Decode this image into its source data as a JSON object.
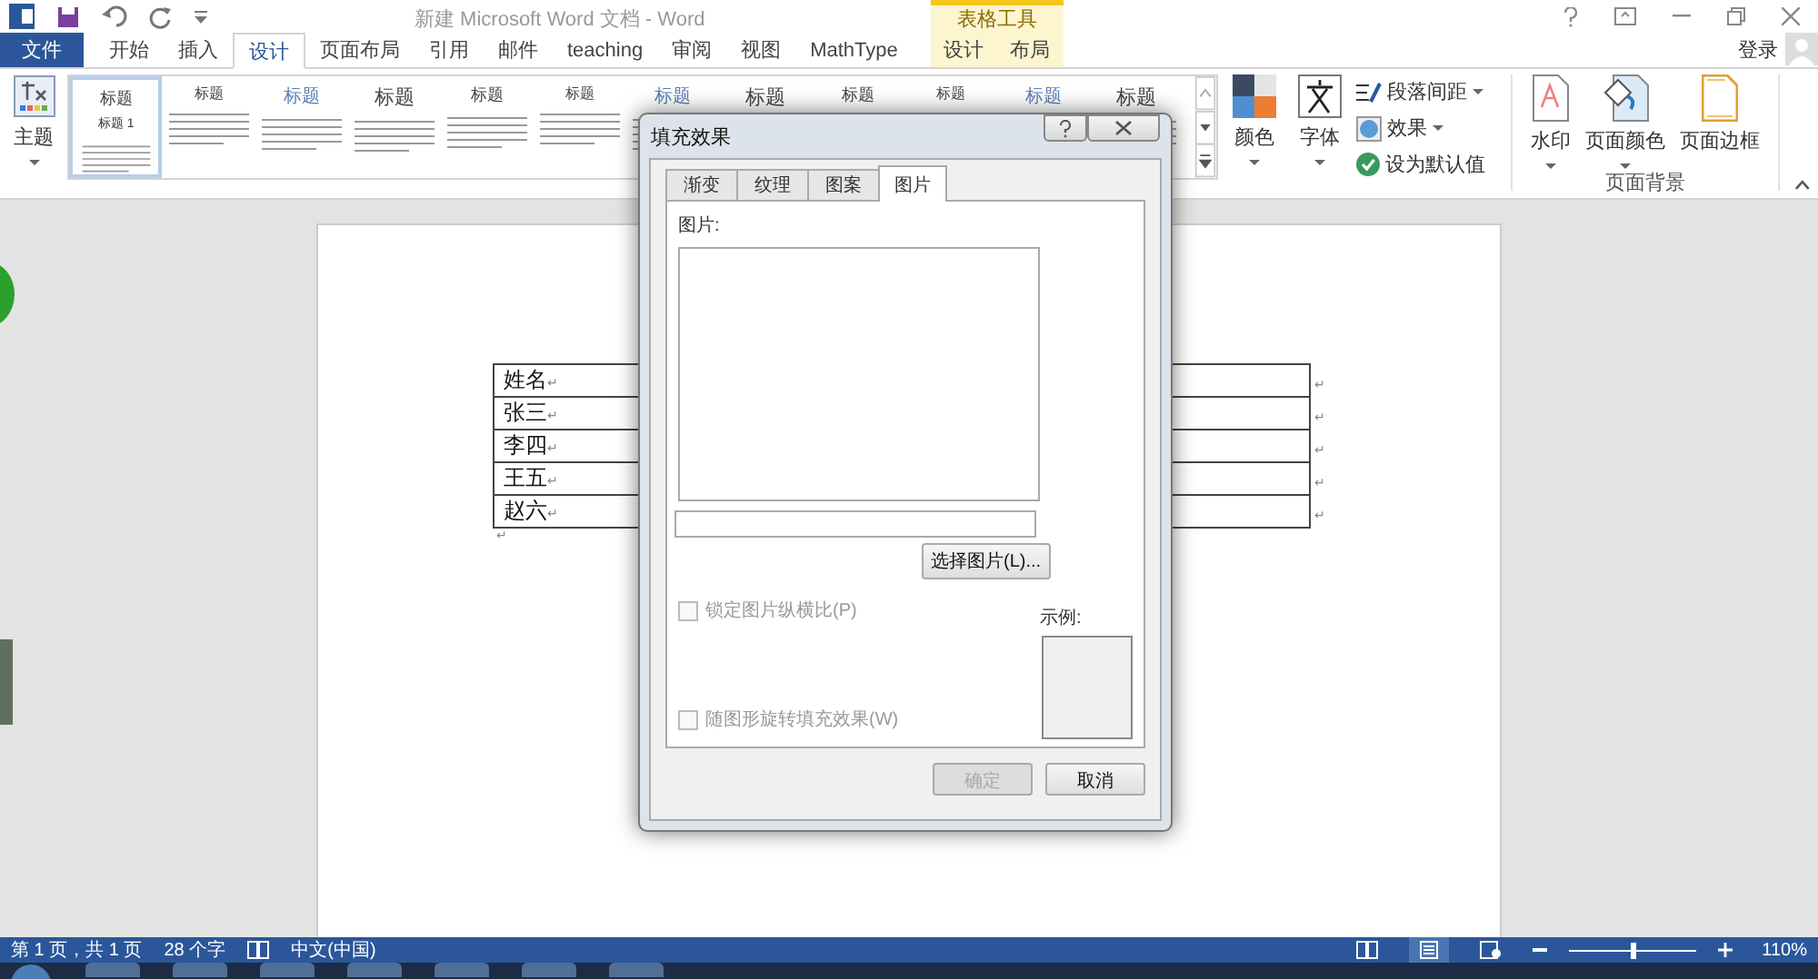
{
  "window": {
    "title": "新建 Microsoft Word 文档 - Word",
    "sign_in": "登录"
  },
  "quick_access": [
    {
      "kind": "save"
    },
    {
      "kind": "undo"
    },
    {
      "kind": "redo"
    },
    {
      "kind": "customize"
    }
  ],
  "tabs": [
    {
      "label": "文件",
      "kind": "file",
      "selected": false
    },
    {
      "label": "开始",
      "kind": "normal",
      "selected": false
    },
    {
      "label": "插入",
      "kind": "normal",
      "selected": false
    },
    {
      "label": "设计",
      "kind": "normal",
      "selected": true
    },
    {
      "label": "页面布局",
      "kind": "normal",
      "selected": false
    },
    {
      "label": "引用",
      "kind": "normal",
      "selected": false
    },
    {
      "label": "邮件",
      "kind": "normal",
      "selected": false
    },
    {
      "label": "teaching",
      "kind": "normal",
      "selected": false
    },
    {
      "label": "审阅",
      "kind": "normal",
      "selected": false
    },
    {
      "label": "视图",
      "kind": "normal",
      "selected": false
    },
    {
      "label": "MathType",
      "kind": "normal",
      "selected": false
    }
  ],
  "context_tabs": {
    "title": "表格工具",
    "tabs": [
      {
        "label": "设计",
        "selected": false
      },
      {
        "label": "布局",
        "selected": false
      }
    ]
  },
  "ribbon": {
    "theme_button": "主题",
    "gallery": [
      {
        "title": "标题",
        "heading": "标题 1",
        "selected": true
      },
      {
        "title": "标题",
        "selected": false
      },
      {
        "title": "标题",
        "selected": false
      },
      {
        "title": "标题",
        "selected": false
      },
      {
        "title": "标题",
        "selected": false
      },
      {
        "title": "标题",
        "selected": false
      },
      {
        "title": "标题",
        "selected": false
      },
      {
        "title": "标题",
        "selected": false
      },
      {
        "title": "标题",
        "selected": false
      },
      {
        "title": "标题",
        "selected": false
      },
      {
        "title": "标题",
        "selected": false
      },
      {
        "title": "标题",
        "selected": false
      }
    ],
    "colors": "颜色",
    "fonts": "字体",
    "paragraph_spacing": "段落间距",
    "effects": "效果",
    "set_default": "设为默认值",
    "page_background": {
      "label": "页面背景",
      "buttons": [
        {
          "label": "水印",
          "kind": "watermark"
        },
        {
          "label": "页面颜色",
          "kind": "color"
        },
        {
          "label": "页面边框",
          "kind": "border"
        }
      ]
    }
  },
  "document": {
    "rows": [
      {
        "name": "姓名",
        "mark": "↵",
        "end_mark": "↵"
      },
      {
        "name": "张三",
        "mark": "↵",
        "end_mark": "↵"
      },
      {
        "name": "李四",
        "mark": "↵",
        "end_mark": "↵"
      },
      {
        "name": "王五",
        "mark": "↵",
        "end_mark": "↵"
      },
      {
        "name": "赵六",
        "mark": "↵",
        "end_mark": "↵"
      }
    ],
    "after_mark": "↵"
  },
  "dialog": {
    "title": "填充效果",
    "tabs": [
      {
        "label": "渐变",
        "selected": false
      },
      {
        "label": "纹理",
        "selected": false
      },
      {
        "label": "图案",
        "selected": false
      },
      {
        "label": "图片",
        "selected": true
      }
    ],
    "picture_label": "图片:",
    "select_button": "选择图片(L)...",
    "checkboxes": [
      {
        "label": "锁定图片纵横比(P)",
        "checked": false,
        "disabled": true
      },
      {
        "label": "随图形旋转填充效果(W)",
        "checked": false,
        "disabled": true
      }
    ],
    "sample_label": "示例:",
    "buttons": [
      {
        "label": "确定",
        "disabled": true
      },
      {
        "label": "取消",
        "disabled": false
      }
    ]
  },
  "status_bar": {
    "page": "第 1 页，共 1 页",
    "words": "28 个字",
    "language": "中文(中国)",
    "views": [
      {
        "kind": "read",
        "selected": false
      },
      {
        "kind": "print",
        "selected": true
      },
      {
        "kind": "web",
        "selected": false
      }
    ],
    "zoom": {
      "level": 0.5,
      "reading": "110%"
    }
  }
}
